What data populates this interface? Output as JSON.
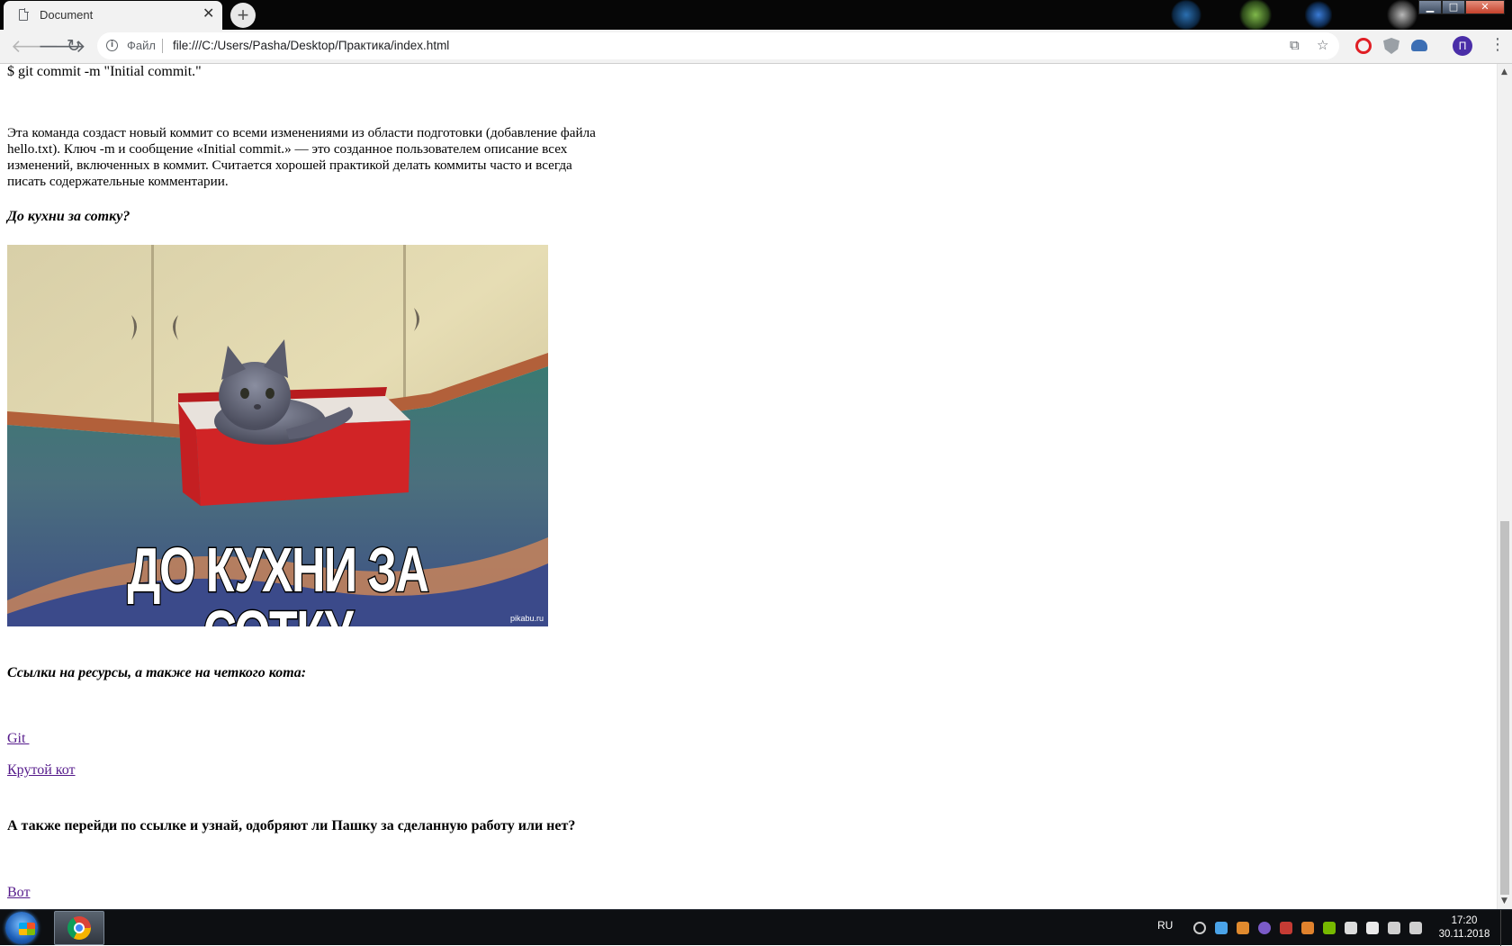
{
  "browser": {
    "tab_title": "Document",
    "tab_close": "✕",
    "new_tab": "+",
    "scheme_label": "Файл",
    "url": "file:///C:/Users/Pasha/Desktop/Практика/index.html",
    "profile_initial": "П",
    "window_controls": {
      "minimize": "▁",
      "maximize": "□",
      "close": "✕"
    }
  },
  "page": {
    "command_line": "$ git commit -m \"Initial commit.\"",
    "paragraph": "Эта команда создаст новый коммит со всеми изменениями из области подготовки (добавление файла hello.txt). Ключ -m и сообщение «Initial commit.» — это созданное пользователем описание всех изменений, включенных в коммит. Считается хорошей практикой делать коммиты часто и всегда писать содержательные комментарии.",
    "heading_kitchen": "До кухни за сотку?",
    "image": {
      "caption": "ДО КУХНИ ЗА СОТКУ",
      "watermark": "pikabu.ru"
    },
    "heading_links": "Ссылки на ресурсы, а также на четкого кота:",
    "link_git": "Git ",
    "link_cat": "Крутой кот",
    "heading_question": "А также перейди по ссылке и узнай, одобряют ли Пашку за сделанную работу или нет?",
    "link_vot": "Вот"
  },
  "taskbar": {
    "language": "RU",
    "time": "17:20",
    "date": "30.11.2018"
  }
}
